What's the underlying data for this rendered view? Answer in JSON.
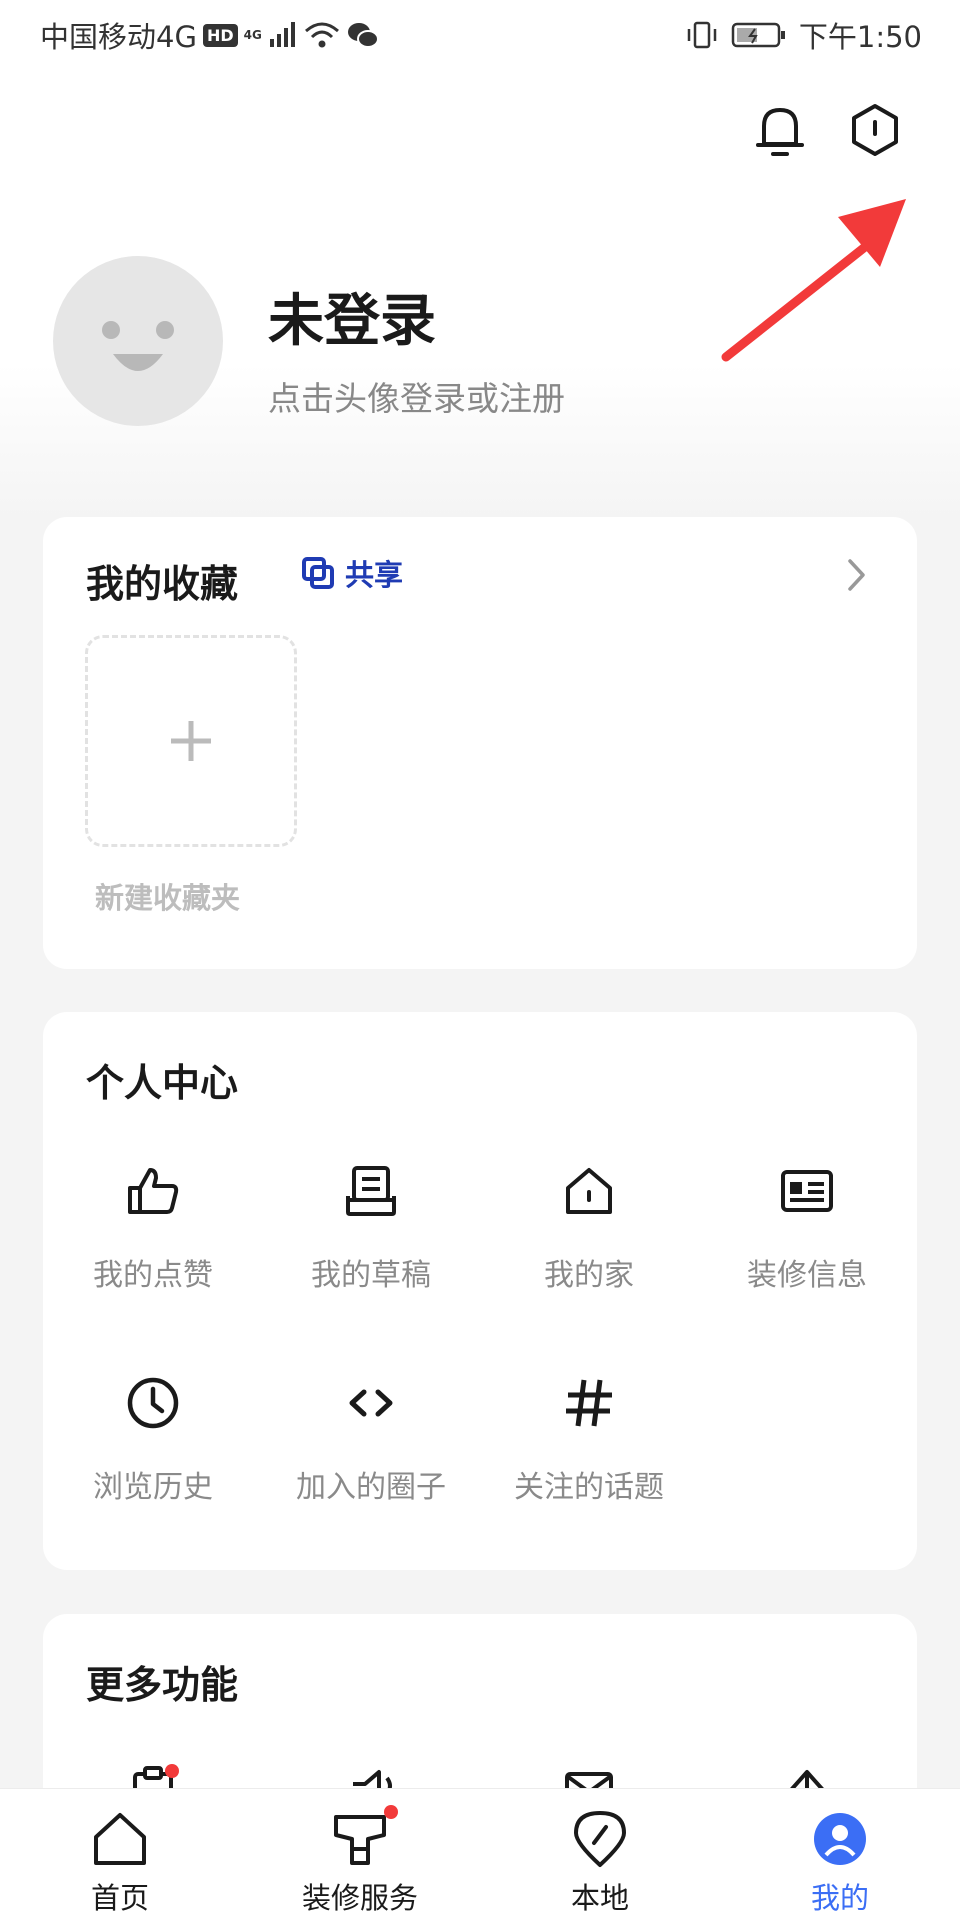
{
  "status_bar": {
    "carrier": "中国移动4G",
    "hd": "HD",
    "network": "4G",
    "time": "下午1:50"
  },
  "profile": {
    "name": "未登录",
    "subtitle": "点击头像登录或注册"
  },
  "favorites": {
    "title": "我的收藏",
    "share_label": "共享",
    "new_folder_label": "新建收藏夹"
  },
  "personal_center": {
    "title": "个人中心",
    "items": [
      {
        "label": "我的点赞",
        "icon": "thumbs-up-icon"
      },
      {
        "label": "我的草稿",
        "icon": "draft-icon"
      },
      {
        "label": "我的家",
        "icon": "home-icon"
      },
      {
        "label": "装修信息",
        "icon": "id-card-icon"
      },
      {
        "label": "浏览历史",
        "icon": "clock-icon"
      },
      {
        "label": "加入的圈子",
        "icon": "code-brackets-icon"
      },
      {
        "label": "关注的话题",
        "icon": "hashtag-icon"
      }
    ]
  },
  "more": {
    "title": "更多功能"
  },
  "bottom_nav": {
    "items": [
      {
        "label": "首页",
        "icon": "home-icon"
      },
      {
        "label": "装修服务",
        "icon": "service-icon"
      },
      {
        "label": "本地",
        "icon": "location-icon"
      },
      {
        "label": "我的",
        "icon": "profile-icon"
      }
    ],
    "active_index": 3
  },
  "colors": {
    "accent_blue": "#1f3bb3",
    "active_tab": "#3b6ef5",
    "annotation_arrow": "#f23a3a",
    "badge_red": "#f23a3a"
  }
}
